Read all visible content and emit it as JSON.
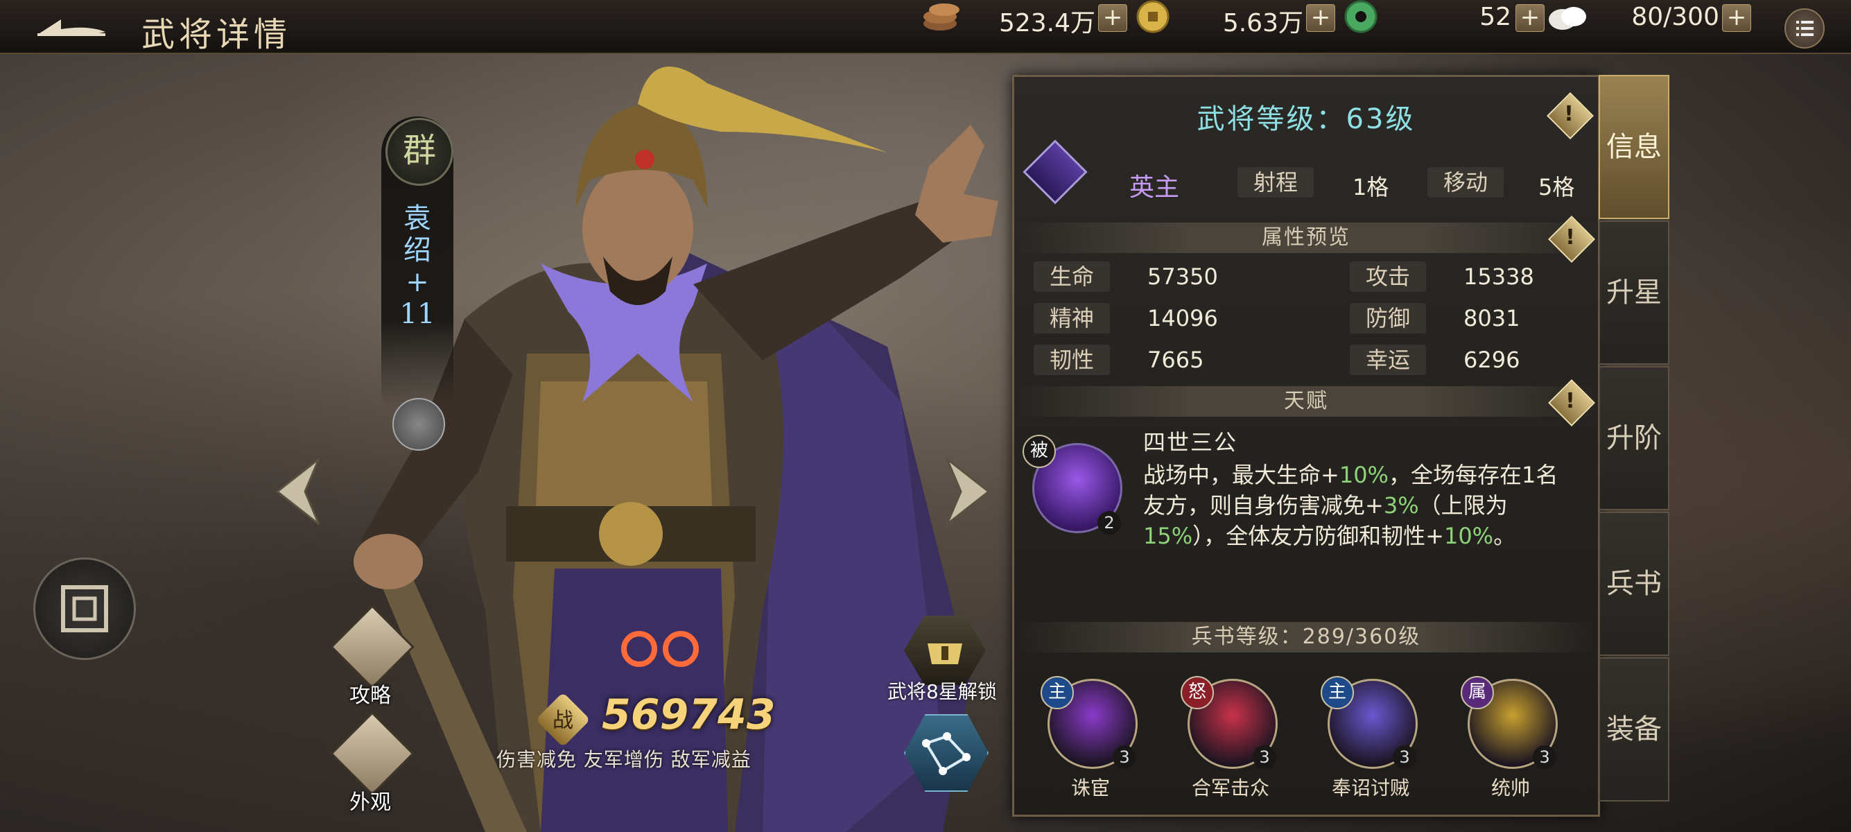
{
  "header": {
    "title": "武将详情",
    "resources": [
      {
        "icon": "coins-stack-icon",
        "value": "523.4万"
      },
      {
        "icon": "gold-coin-icon",
        "value": "5.63万"
      },
      {
        "icon": "jade-disc-icon",
        "value": "52"
      },
      {
        "icon": "stamina-bun-icon",
        "value": "80/300"
      }
    ],
    "plus": "+"
  },
  "hero": {
    "faction": "群",
    "name_chars": [
      "袁",
      "绍",
      "+",
      "11"
    ],
    "power_label": "战",
    "power": "569743",
    "power_tags": "伤害减免 友军增伤 敌军减益",
    "star_unlock": "武将8星解锁",
    "guide": "攻略",
    "appearance": "外观"
  },
  "panel": {
    "level_title": "武将等级：63级",
    "info_mark": "!",
    "role": "英主",
    "range_label": "射程",
    "range_value": "1格",
    "move_label": "移动",
    "move_value": "5格",
    "attr_section": "属性预览",
    "attrs": [
      {
        "label": "生命",
        "value": "57350"
      },
      {
        "label": "攻击",
        "value": "15338"
      },
      {
        "label": "精神",
        "value": "14096"
      },
      {
        "label": "防御",
        "value": "8031"
      },
      {
        "label": "韧性",
        "value": "7665"
      },
      {
        "label": "幸运",
        "value": "6296"
      }
    ],
    "talent_section": "天赋",
    "talent": {
      "badge": "被",
      "level": "2",
      "name": "四世三公",
      "desc_parts": [
        {
          "t": "战场中，最大生命+",
          "hl": false
        },
        {
          "t": "10%",
          "hl": true
        },
        {
          "t": "，全场每存在1名友方，则自身伤害减免+",
          "hl": false
        },
        {
          "t": "3%",
          "hl": true
        },
        {
          "t": "（上限为",
          "hl": false
        },
        {
          "t": "15%",
          "hl": true
        },
        {
          "t": "），全体友方防御和韧性+",
          "hl": false
        },
        {
          "t": "10%",
          "hl": true
        },
        {
          "t": "。",
          "hl": false
        }
      ]
    },
    "book_section": "兵书等级：289/360级",
    "skills": [
      {
        "badge": "主",
        "badge_color": "#1f4a8a",
        "level": "3",
        "name": "诛宦",
        "orb": "#8a3ac8"
      },
      {
        "badge": "怒",
        "badge_color": "#8a1f2a",
        "level": "3",
        "name": "合军击众",
        "orb": "#c8324a"
      },
      {
        "badge": "主",
        "badge_color": "#1f4a8a",
        "level": "3",
        "name": "奉诏讨贼",
        "orb": "#6a58d0"
      },
      {
        "badge": "属",
        "badge_color": "#5a2a7a",
        "level": "3",
        "name": "统帅",
        "orb": "#c8a030"
      }
    ]
  },
  "tabs": [
    {
      "label": "信息",
      "active": true
    },
    {
      "label": "升星",
      "active": false
    },
    {
      "label": "升阶",
      "active": false
    },
    {
      "label": "兵书",
      "active": false
    },
    {
      "label": "装备",
      "active": false
    }
  ]
}
